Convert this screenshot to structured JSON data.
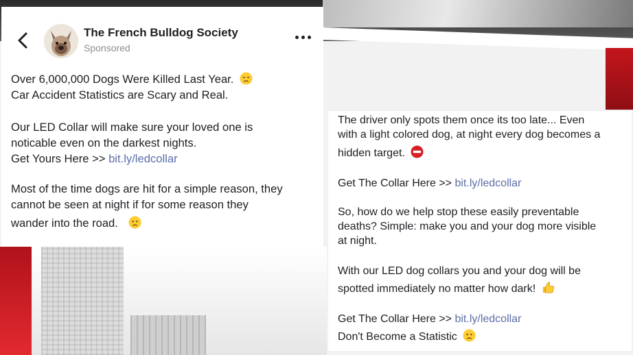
{
  "post": {
    "page_name": "The French Bulldog Society",
    "sponsored": "Sponsored",
    "p1_line1": "Over 6,000,000 Dogs Were Killed Last Year.",
    "p1_line2": "Car Accident Statistics are Scary and Real.",
    "p2_line1": "Our LED Collar will make sure your loved one is",
    "p2_line2": "noticable even on the darkest nights.",
    "p2_line3": "Get Yours Here >>",
    "p2_link": "bit.ly/ledcollar",
    "p3_line1": "Most of the time dogs are hit for a simple reason, they",
    "p3_line2": "cannot be seen at night if for some reason they",
    "p3_line3": "wander into the road."
  },
  "continuation": {
    "p1_line1": "The driver only spots them once its too late... Even",
    "p1_line2": "with a light colored dog, at night every dog becomes a",
    "p1_line3": "hidden target.",
    "p2_text": "Get The Collar Here >>",
    "p2_link": "bit.ly/ledcollar",
    "p3_line1": "So, how do we help stop these easily preventable",
    "p3_line2": "deaths? Simple: make you and your dog more visible",
    "p3_line3": "at night.",
    "p4_line1": "With our LED dog collars you and your dog will be",
    "p4_line2": "spotted immediately no matter how dark!",
    "p5_text": "Get The Collar Here >>",
    "p5_link": "bit.ly/ledcollar",
    "p5_line2": "Don't Become a Statistic"
  },
  "icons": {
    "back": "chevron-left-icon",
    "more": "more-dots-icon",
    "emoji_sad": "disappointed-face-emoji",
    "emoji_worried": "worried-face-emoji",
    "emoji_no_entry": "no-entry-emoji",
    "emoji_thumbs": "thumbs-up-emoji"
  },
  "colors": {
    "link": "#5b6ea8",
    "text": "#1c1e21",
    "muted": "#8a8d91",
    "accent_red": "#d61f26"
  }
}
